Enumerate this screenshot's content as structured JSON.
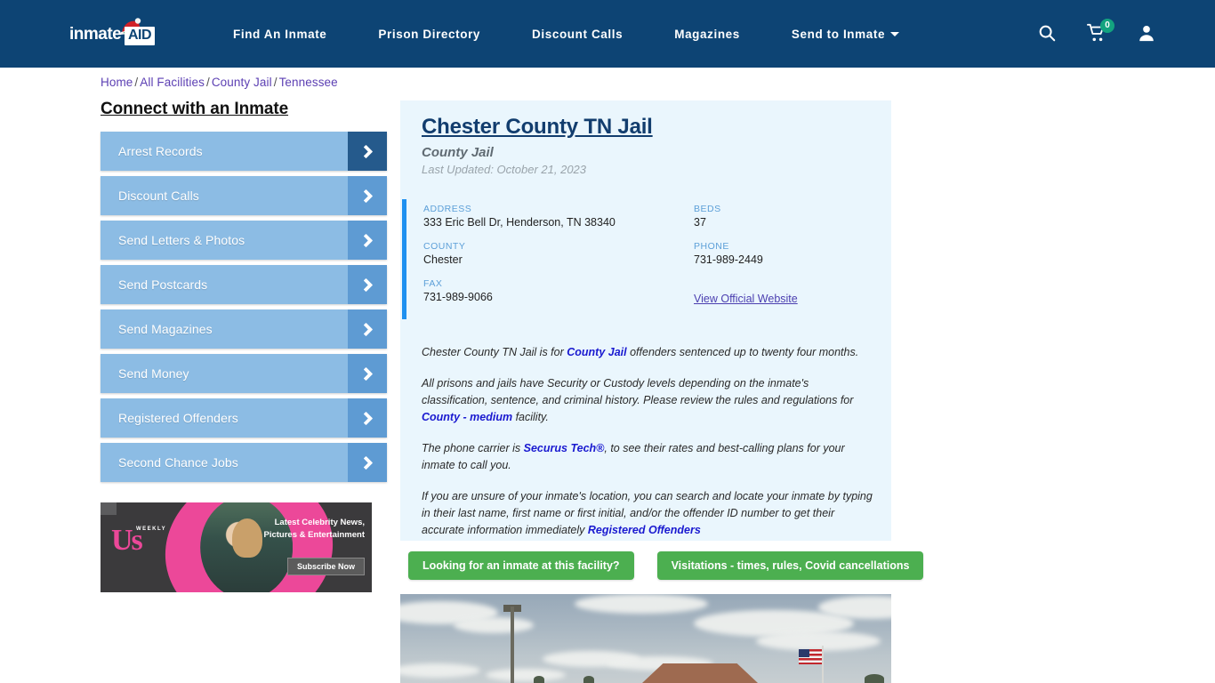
{
  "header": {
    "logo_text": "inmate",
    "logo_badge": "AID",
    "nav": [
      {
        "label": "Find An Inmate",
        "has_caret": false
      },
      {
        "label": "Prison Directory",
        "has_caret": false
      },
      {
        "label": "Discount Calls",
        "has_caret": false
      },
      {
        "label": "Magazines",
        "has_caret": false
      },
      {
        "label": "Send to Inmate",
        "has_caret": true
      }
    ],
    "icons": {
      "search": "search-icon",
      "cart": "cart-icon",
      "account": "user-icon"
    },
    "cart_count": "0",
    "bg_color": "#0d4474",
    "badge_color": "#13a37f"
  },
  "breadcrumb": {
    "items": [
      "Home",
      "All Facilities",
      "County Jail",
      "Tennessee"
    ],
    "separator": "/",
    "link_color": "#5c3fb3"
  },
  "sidebar": {
    "title": "Connect with an Inmate",
    "items": [
      {
        "label": "Arrest Records"
      },
      {
        "label": "Discount Calls"
      },
      {
        "label": "Send Letters & Photos"
      },
      {
        "label": "Send Postcards"
      },
      {
        "label": "Send Magazines"
      },
      {
        "label": "Send Money"
      },
      {
        "label": "Registered Offenders"
      },
      {
        "label": "Second Chance Jobs"
      }
    ],
    "button_color": "#8cbce4",
    "arrow_box_color": "#5e9bd3",
    "arrow_box_active_color": "#255a8c"
  },
  "ad": {
    "brand": "Us",
    "brand_sub": "WEEKLY",
    "headline": "Latest Celebrity News, Pictures & Entertainment",
    "cta": "Subscribe Now",
    "accent_color": "#ec4899"
  },
  "facility": {
    "title": "Chester County TN Jail",
    "subtitle": "County Jail",
    "last_updated": "Last Updated: October 21, 2023",
    "accent_bar_color": "#1e90f0",
    "card_bg": "#eaf6fd",
    "details": {
      "address_label": "ADDRESS",
      "address_value": "333 Eric Bell Dr, Henderson, TN 38340",
      "beds_label": "BEDS",
      "beds_value": "37",
      "county_label": "COUNTY",
      "county_value": "Chester",
      "phone_label": "PHONE",
      "phone_value": "731-989-2449",
      "fax_label": "FAX",
      "fax_value": "731-989-9066",
      "website_link": "View Official Website"
    },
    "paragraphs": {
      "p1_a": "Chester County TN Jail is for ",
      "p1_link": "County Jail",
      "p1_b": " offenders sentenced up to twenty four months.",
      "p2_a": "All prisons and jails have Security or Custody levels depending on the inmate's classification, sentence, and criminal history. Please review the rules and regulations for ",
      "p2_link": "County - medium",
      "p2_b": " facility.",
      "p3_a": "The phone carrier is ",
      "p3_link": "Securus Tech®",
      "p3_b": ", to see their rates and best-calling plans for your inmate to call you.",
      "p4_a": "If you are unsure of your inmate's location, you can search and locate your inmate by typing in their last name, first name or first initial, and/or the offender ID number to get their accurate information immediately ",
      "p4_link": "Registered Offenders"
    }
  },
  "cta_buttons": [
    {
      "label": "Looking for an inmate at this facility?"
    },
    {
      "label": "Visitations - times, rules, Covid cancellations"
    }
  ],
  "cta_color": "#4caf50",
  "photo": {
    "caption": "facility-exterior-photo"
  }
}
